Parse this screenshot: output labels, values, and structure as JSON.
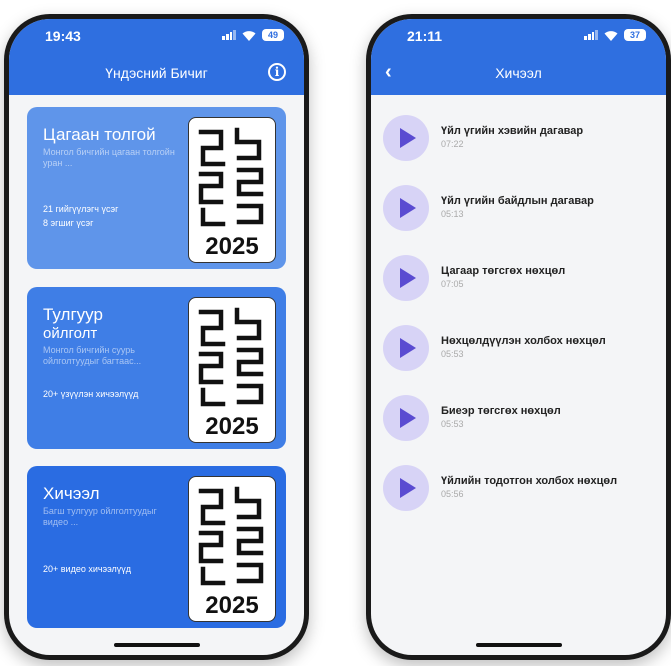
{
  "left_screen": {
    "status": {
      "time": "19:43",
      "battery": "49"
    },
    "header_title": "Үндэсний Бичиг",
    "cards": [
      {
        "title": "Цагаан толгой",
        "desc": "Монгол бичгийн цагаан толгойн уран ...",
        "meta1": "21 гийгүүлэгч үсэг",
        "meta2": "8 эгшиг үсэг"
      },
      {
        "title": "Тулгуур",
        "subtitle": "ойлголт",
        "desc": "Монгол бичгийн суурь ойлголтуудыг багтаас...",
        "meta1": "20+ үзүүлэн хичээлүүд"
      },
      {
        "title": "Хичээл",
        "desc": "Багш тулгуур ойлголтуудыг видео ...",
        "meta1": "20+ видео хичээлүүд"
      }
    ],
    "logo_year": "2025"
  },
  "right_screen": {
    "status": {
      "time": "21:11",
      "battery": "37"
    },
    "header_title": "Хичээл",
    "lessons": [
      {
        "title": "Үйл үгийн хэвийн дагавар",
        "duration": "07:22"
      },
      {
        "title": "Үйл үгийн байдлын дагавар",
        "duration": "05:13"
      },
      {
        "title": "Цагаар төгсгөх нөхцөл",
        "duration": "07:05"
      },
      {
        "title": "Нөхцөлдүүлэн холбох нөхцөл",
        "duration": "05:53"
      },
      {
        "title": "Биеэр төгсгөх нөхцөл",
        "duration": "05:53"
      },
      {
        "title": "Үйлийн тодотгон холбох нөхцөл",
        "duration": "05:56"
      }
    ]
  },
  "colors": {
    "primary": "#2f6fe0",
    "play_bg": "#d7d3f6",
    "play_icon": "#5a4bd1"
  }
}
